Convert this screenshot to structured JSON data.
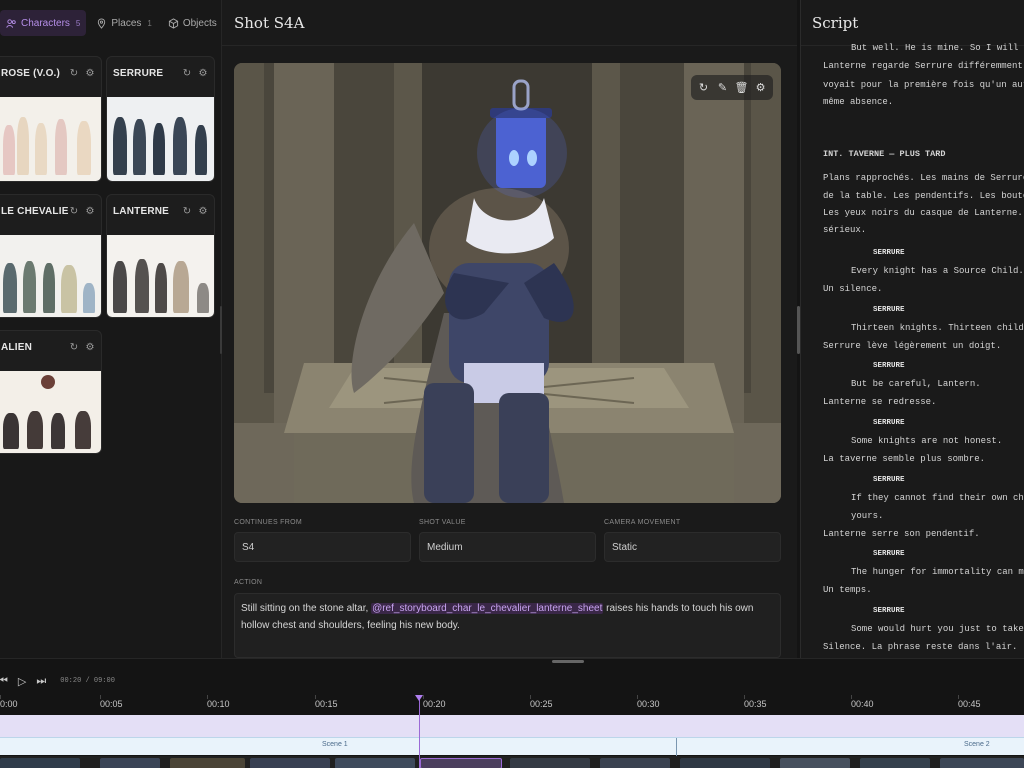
{
  "left_panel": {
    "tabs": [
      {
        "label": "Characters",
        "count": "5",
        "icon": "people-icon",
        "active": true
      },
      {
        "label": "Places",
        "count": "1",
        "icon": "map-pin-icon",
        "active": false
      },
      {
        "label": "Objects",
        "count": "0",
        "icon": "cube-icon",
        "active": false
      }
    ],
    "cards": [
      {
        "title": "ROSE (V.O.)"
      },
      {
        "title": "SERRURE"
      },
      {
        "title": "LE CHEVALIE..."
      },
      {
        "title": "LANTERNE"
      },
      {
        "title": "ALIEN"
      }
    ],
    "card_icons": [
      "refresh-icon",
      "settings-icon"
    ]
  },
  "shot": {
    "title": "Shot S4A",
    "tools": [
      "refresh-icon",
      "pencil-icon",
      "trash-icon",
      "settings-icon"
    ],
    "fields": {
      "continues_from": {
        "label": "CONTINUES FROM",
        "value": "S4"
      },
      "shot_value": {
        "label": "SHOT VALUE",
        "value": "Medium"
      },
      "camera_movement": {
        "label": "CAMERA MOVEMENT",
        "value": "Static"
      }
    },
    "action": {
      "label": "ACTION",
      "text_before": "Still sitting on the stone altar, ",
      "mention": "@ref_storyboard_char_le_chevalier_lanterne_sheet",
      "text_after": " raises his hands to touch his own hollow chest and shoulders, feeling his new body."
    }
  },
  "script": {
    "title": "Script",
    "lines": [
      {
        "type": "dlg",
        "text": "But well. He is mine. So I will find"
      },
      {
        "type": "action",
        "text": "Lanterne regarde Serrure différemment main"
      },
      {
        "type": "action",
        "text": "voyait pour la première fois qu'un autre c"
      },
      {
        "type": "action",
        "text": "même absence."
      },
      {
        "type": "head",
        "text": "INT. TAVERNE — PLUS TARD"
      },
      {
        "type": "action",
        "text": "Plans rapprochés. Les mains de Serrure qui"
      },
      {
        "type": "action",
        "text": "de la table. Les pendentifs. Les bouteille"
      },
      {
        "type": "action",
        "text": "Les yeux noirs du casque de Lanterne. Serr"
      },
      {
        "type": "action",
        "text": "sérieux."
      },
      {
        "type": "char",
        "text": "SERRURE"
      },
      {
        "type": "dlg",
        "text": "Every knight has a Source Child."
      },
      {
        "type": "action",
        "text": "Un silence."
      },
      {
        "type": "char",
        "text": "SERRURE"
      },
      {
        "type": "dlg",
        "text": "Thirteen knights. Thirteen children."
      },
      {
        "type": "action",
        "text": "Serrure lève légèrement un doigt."
      },
      {
        "type": "char",
        "text": "SERRURE"
      },
      {
        "type": "dlg",
        "text": "But be careful, Lantern."
      },
      {
        "type": "action",
        "text": "Lanterne se redresse."
      },
      {
        "type": "char",
        "text": "SERRURE"
      },
      {
        "type": "dlg",
        "text": "Some knights are not honest."
      },
      {
        "type": "action",
        "text": "La taverne semble plus sombre."
      },
      {
        "type": "char",
        "text": "SERRURE"
      },
      {
        "type": "dlg",
        "text": "If they cannot find their own child,"
      },
      {
        "type": "dlg",
        "text": "yours."
      },
      {
        "type": "action",
        "text": "Lanterne serre son pendentif."
      },
      {
        "type": "char",
        "text": "SERRURE"
      },
      {
        "type": "dlg",
        "text": "The hunger for immortality can make"
      },
      {
        "type": "action",
        "text": "Un temps."
      },
      {
        "type": "char",
        "text": "SERRURE"
      },
      {
        "type": "dlg",
        "text": "Some would hurt you just to take you"
      },
      {
        "type": "action",
        "text": "Silence. La phrase reste dans l'air."
      }
    ]
  },
  "timeline": {
    "timecode": "00:20 / 09:00",
    "ticks": [
      "0:00",
      "00:05",
      "00:10",
      "00:15",
      "00:20",
      "00:25",
      "00:30",
      "00:35",
      "00:40",
      "00:45"
    ],
    "scenes": [
      "Scene 1",
      "Scene 2"
    ],
    "playhead_time": "00:20"
  }
}
